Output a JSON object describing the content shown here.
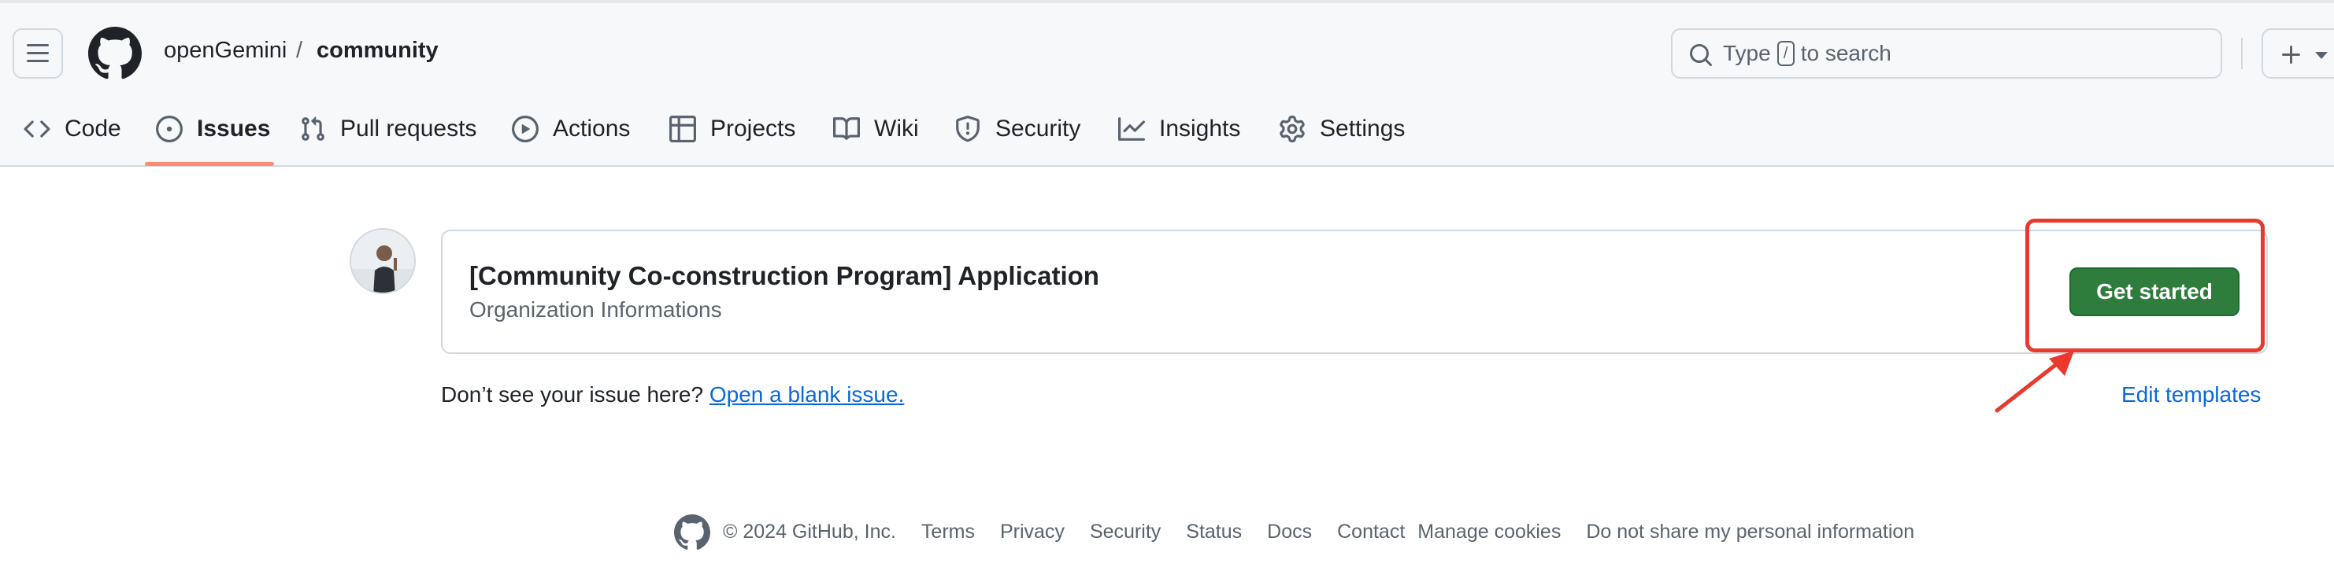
{
  "header": {
    "owner": "openGemini",
    "separator": "/",
    "repo": "community",
    "search_prefix": "Type",
    "search_key": "/",
    "search_suffix": "to search"
  },
  "tabs": [
    {
      "label": "Code",
      "icon": "code-icon"
    },
    {
      "label": "Issues",
      "icon": "issue-opened-icon",
      "selected": true
    },
    {
      "label": "Pull requests",
      "icon": "pull-request-icon"
    },
    {
      "label": "Actions",
      "icon": "play-icon"
    },
    {
      "label": "Projects",
      "icon": "table-icon"
    },
    {
      "label": "Wiki",
      "icon": "book-icon"
    },
    {
      "label": "Security",
      "icon": "shield-icon"
    },
    {
      "label": "Insights",
      "icon": "graph-icon"
    },
    {
      "label": "Settings",
      "icon": "gear-icon"
    }
  ],
  "template_card": {
    "title": "[Community Co-construction Program] Application",
    "subtitle": "Organization Informations",
    "button_label": "Get started"
  },
  "helper": {
    "text": "Don’t see your issue here?",
    "link": "Open a blank issue.",
    "edit_templates": "Edit templates"
  },
  "footer": {
    "copyright": "© 2024 GitHub, Inc.",
    "links": [
      "Terms",
      "Privacy",
      "Security",
      "Status",
      "Docs",
      "Contact",
      "Manage cookies",
      "Do not share my personal information"
    ]
  },
  "colors": {
    "accent_green": "#2e7d3c",
    "link_blue": "#0969da",
    "highlight_red": "#e8392c",
    "tab_underline": "#fd8c73"
  }
}
